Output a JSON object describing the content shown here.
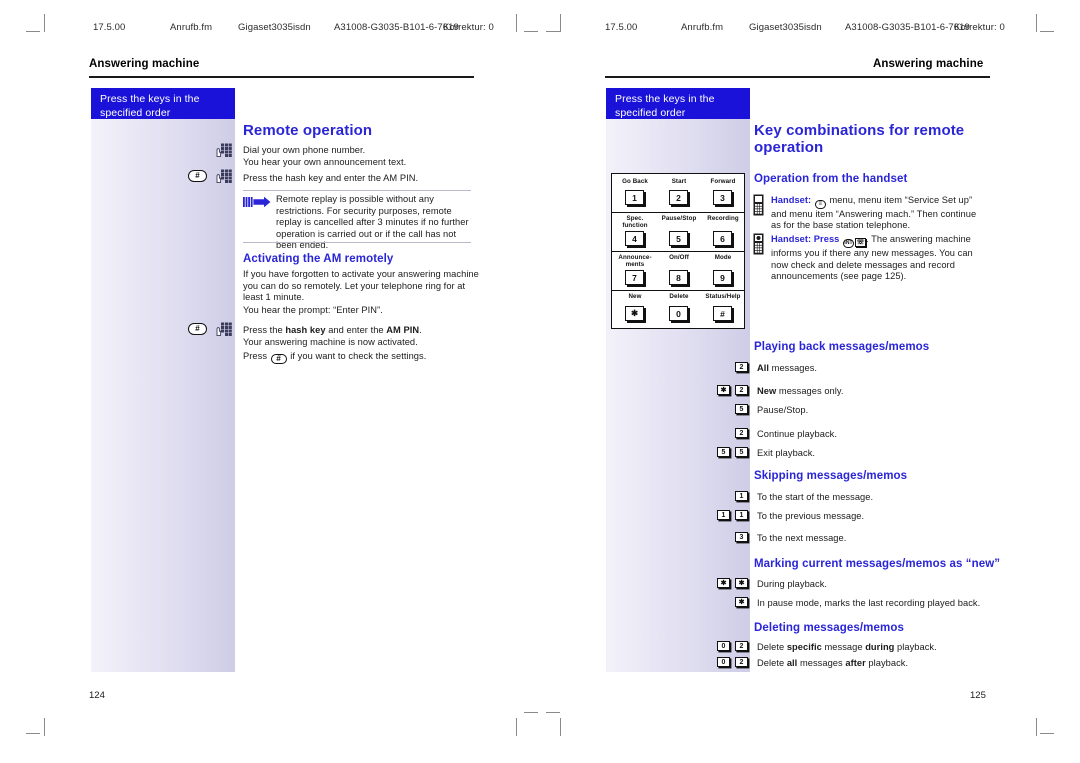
{
  "document": {
    "type": "print-proof-spread",
    "page_size": "1080x763"
  },
  "runheads": {
    "left": {
      "date": "17.5.00",
      "file": "Anrufb.fm",
      "product": "Gigaset3035isdn",
      "docnum": "A31008-G3035-B101-6-7619",
      "correction": "Korrektur: 0"
    },
    "right": {
      "date": "17.5.00",
      "file": "Anrufb.fm",
      "product": "Gigaset3035isdn",
      "docnum": "A31008-G3035-B101-6-7619",
      "correction": "Korrektur: 0"
    }
  },
  "left_page": {
    "chapter_title": "Answering machine",
    "folio": "124",
    "banner": "Press the keys in the specified order",
    "section_title": "Remote operation",
    "steps": [
      {
        "icons": [
          "keypad-hand-icon"
        ],
        "lines": [
          "Dial your own phone number.",
          "You hear your own announcement text."
        ]
      },
      {
        "icons": [
          "hash-key-icon",
          "keypad-hand-icon"
        ],
        "lines": [
          "Press the hash key and enter the AM PIN."
        ]
      }
    ],
    "note": {
      "icon": "note-arrow-icon",
      "text": "Remote replay is possible without any restrictions. For security purposes, remote replay is cancelled after 3 minutes if no further operation is carried out or if the call has not been ended."
    },
    "subsection_title": "Activating the AM remotely",
    "para1": "If you have forgotten to activate your answering machine you can do so remotely. Let your telephone ring for at least 1 minute.",
    "para2": "You hear the prompt: “Enter PIN”.",
    "step3": {
      "icons": [
        "hash-key-icon",
        "keypad-hand-icon"
      ],
      "line1_a": "Press the ",
      "line1_b": "hash key",
      "line1_c": " and enter the ",
      "line1_d": "AM PIN",
      "line1_e": ".",
      "line2": "Your answering machine is now activated."
    },
    "para3_a": "Press ",
    "para3_b": " if you want to check the settings."
  },
  "right_page": {
    "chapter_title": "Answering machine",
    "folio": "125",
    "banner": "Press the keys in the specified order",
    "section_title": "Key combinations for remote operation",
    "keymap": {
      "rows": [
        {
          "captions": [
            "Go Back",
            "Start",
            "Forward"
          ],
          "keys": [
            "1",
            "2",
            "3"
          ]
        },
        {
          "captions": [
            "Spec. function",
            "Pause/Stop",
            "Recording"
          ],
          "keys": [
            "4",
            "5",
            "6"
          ]
        },
        {
          "captions": [
            "Announce- ments",
            "On/Off",
            "Mode"
          ],
          "keys": [
            "7",
            "8",
            "9"
          ]
        },
        {
          "captions": [
            "New",
            "Delete",
            "Status/Help"
          ],
          "keys": [
            "✱",
            "0",
            "#"
          ]
        }
      ]
    },
    "handset_section": {
      "title": "Operation from the handset",
      "items": [
        {
          "icon": "handset-icon",
          "label": "Handset:",
          "text_a": " menu, menu item “Service Set up” and menu item “Answering mach.” Then continue as for the base station telephone.",
          "inline_icon": "menu-key-icon"
        },
        {
          "icon": "handset-icon",
          "label": "Handset: Press",
          "text_a": ". The answering machine informs you if there any new messages. You can now check and delete messages and record announcements (see page 125).",
          "inline_icons": [
            "int-key-icon",
            "am-key-icon"
          ]
        }
      ]
    },
    "groups": [
      {
        "title": "Playing back messages/memos",
        "rows": [
          {
            "keys": [
              "2"
            ],
            "bold": "All",
            "rest": " messages."
          },
          {
            "keys": [
              "✱",
              "2"
            ],
            "bold": "New",
            "rest": " messages only."
          },
          {
            "keys": [
              "5"
            ],
            "bold": "",
            "rest": "Pause/Stop."
          },
          {
            "keys": [
              "2"
            ],
            "bold": "",
            "rest": "Continue playback."
          },
          {
            "keys": [
              "5",
              "5"
            ],
            "bold": "",
            "rest": "Exit playback."
          }
        ]
      },
      {
        "title": "Skipping messages/memos",
        "rows": [
          {
            "keys": [
              "1"
            ],
            "bold": "",
            "rest": "To the start of the message."
          },
          {
            "keys": [
              "1",
              "1"
            ],
            "bold": "",
            "rest": "To the previous message."
          },
          {
            "keys": [
              "3"
            ],
            "bold": "",
            "rest": "To the next message."
          }
        ]
      },
      {
        "title": "Marking current messages/memos as “new”",
        "rows": [
          {
            "keys": [
              "✱",
              "✱"
            ],
            "bold": "",
            "rest": "During playback."
          },
          {
            "keys": [
              "✱"
            ],
            "bold": "",
            "rest": "In pause mode, marks the last recording played back."
          }
        ]
      },
      {
        "title": "Deleting messages/memos",
        "rows": [
          {
            "keys": [
              "0",
              "2"
            ],
            "pre": "Delete ",
            "bold": "specific",
            "mid": " message ",
            "bold2": "during",
            "rest": " playback."
          },
          {
            "keys": [
              "0",
              "2"
            ],
            "pre": "Delete ",
            "bold": "all",
            "mid": " messages ",
            "bold2": "after",
            "rest": " playback."
          }
        ]
      }
    ]
  },
  "colors": {
    "accent_blue": "#2a25d6",
    "banner_blue": "#1a12d8",
    "margin_light": "#f3f2fa",
    "margin_dark": "#cfcde6",
    "rule_black": "#1a1a1a"
  }
}
